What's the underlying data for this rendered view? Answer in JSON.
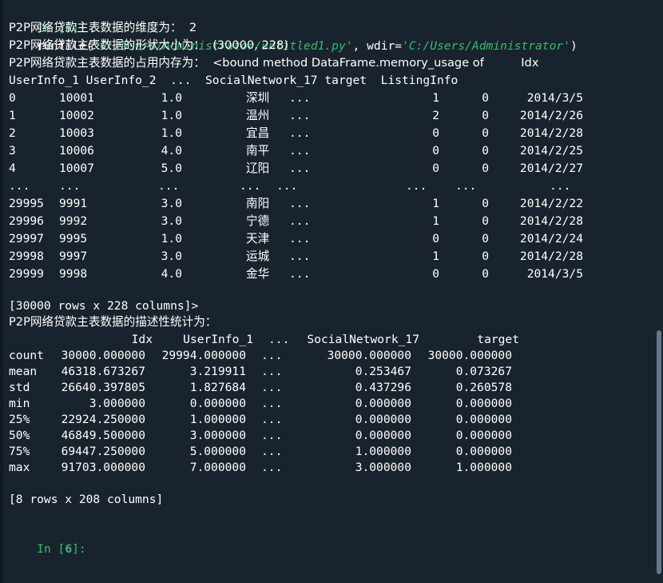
{
  "input_prompt_1": {
    "prefix": "In [",
    "number": "5",
    "suffix": "]:"
  },
  "command": {
    "fn": "runfile(",
    "arg1": "'C:/Users/Administrator/untitled1.py'",
    "mid": ", wdir=",
    "arg2": "'C:/Users/Administrator'",
    "end": ")"
  },
  "output_lines": {
    "dims": "P2P网络贷款主表数据的维度为：  2",
    "shape": "P2P网络贷款主表数据的形状大小为：  (30000, 228)",
    "memory": "P2P网络贷款主表数据的占用内存为：  <bound method DataFrame.memory_usage of          Idx",
    "memory_header": "UserInfo_1 UserInfo_2  ...  SocialNetwork_17 target  ListingInfo",
    "rows_summary": "[30000 rows x 228 columns]>",
    "describe_title": "P2P网络贷款主表数据的描述性统计为：",
    "describe_summary": "[8 rows x 208 columns]"
  },
  "data_rows": [
    {
      "index": "0",
      "idx": "10001",
      "u1": "1.0",
      "u2": "深圳",
      "dots": "...",
      "sn": "1",
      "target": "0",
      "date": "2014/3/5"
    },
    {
      "index": "1",
      "idx": "10002",
      "u1": "1.0",
      "u2": "温州",
      "dots": "...",
      "sn": "2",
      "target": "0",
      "date": "2014/2/26"
    },
    {
      "index": "2",
      "idx": "10003",
      "u1": "1.0",
      "u2": "宜昌",
      "dots": "...",
      "sn": "0",
      "target": "0",
      "date": "2014/2/28"
    },
    {
      "index": "3",
      "idx": "10006",
      "u1": "4.0",
      "u2": "南平",
      "dots": "...",
      "sn": "0",
      "target": "0",
      "date": "2014/2/25"
    },
    {
      "index": "4",
      "idx": "10007",
      "u1": "5.0",
      "u2": "辽阳",
      "dots": "...",
      "sn": "0",
      "target": "0",
      "date": "2014/2/27"
    },
    {
      "index": "...",
      "idx": "...",
      "u1": "...",
      "u2": "...",
      "dots": "...",
      "sn": "...",
      "target": "...",
      "date": "..."
    },
    {
      "index": "29995",
      "idx": "9991",
      "u1": "3.0",
      "u2": "南阳",
      "dots": "...",
      "sn": "1",
      "target": "0",
      "date": "2014/2/22"
    },
    {
      "index": "29996",
      "idx": "9992",
      "u1": "3.0",
      "u2": "宁德",
      "dots": "...",
      "sn": "1",
      "target": "0",
      "date": "2014/2/28"
    },
    {
      "index": "29997",
      "idx": "9995",
      "u1": "1.0",
      "u2": "天津",
      "dots": "...",
      "sn": "0",
      "target": "0",
      "date": "2014/2/24"
    },
    {
      "index": "29998",
      "idx": "9997",
      "u1": "3.0",
      "u2": "运城",
      "dots": "...",
      "sn": "1",
      "target": "0",
      "date": "2014/2/28"
    },
    {
      "index": "29999",
      "idx": "9998",
      "u1": "4.0",
      "u2": "金华",
      "dots": "...",
      "sn": "0",
      "target": "0",
      "date": "2014/3/5"
    }
  ],
  "describe_header": {
    "idx": "Idx",
    "u1": "UserInfo_1",
    "dots": "...",
    "sn": "SocialNetwork_17",
    "target": "target"
  },
  "describe_rows": [
    {
      "stat": "count",
      "idx": "30000.000000",
      "u1": "29994.000000",
      "dots": "...",
      "sn": "30000.000000",
      "target": "30000.000000"
    },
    {
      "stat": "mean",
      "idx": "46318.673267",
      "u1": "3.219911",
      "dots": "...",
      "sn": "0.253467",
      "target": "0.073267"
    },
    {
      "stat": "std",
      "idx": "26640.397805",
      "u1": "1.827684",
      "dots": "...",
      "sn": "0.437296",
      "target": "0.260578"
    },
    {
      "stat": "min",
      "idx": "3.000000",
      "u1": "0.000000",
      "dots": "...",
      "sn": "0.000000",
      "target": "0.000000"
    },
    {
      "stat": "25%",
      "idx": "22924.250000",
      "u1": "1.000000",
      "dots": "...",
      "sn": "0.000000",
      "target": "0.000000"
    },
    {
      "stat": "50%",
      "idx": "46849.500000",
      "u1": "3.000000",
      "dots": "...",
      "sn": "0.000000",
      "target": "0.000000"
    },
    {
      "stat": "75%",
      "idx": "69447.250000",
      "u1": "5.000000",
      "dots": "...",
      "sn": "1.000000",
      "target": "0.000000"
    },
    {
      "stat": "max",
      "idx": "91703.000000",
      "u1": "7.000000",
      "dots": "...",
      "sn": "3.000000",
      "target": "1.000000"
    }
  ],
  "input_prompt_2": {
    "prefix": "In [",
    "number": "6",
    "suffix": "]:"
  },
  "colors": {
    "background": "#19232d",
    "prompt": "#2fbf71",
    "text": "#ffffff",
    "scrollbar": "#60798b"
  }
}
